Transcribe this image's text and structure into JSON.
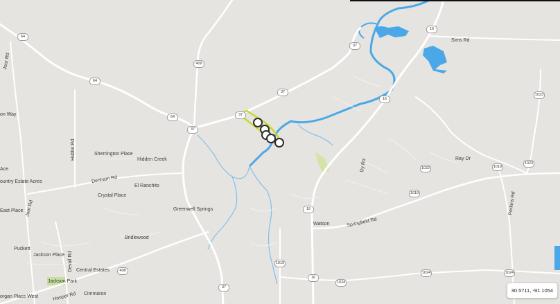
{
  "coordinates": "30.5711, -91.1054",
  "place_labels": {
    "sims_rd": "Sims Rd",
    "on_way": "on Way",
    "joor_rd_top": "Joor Rd",
    "hubbs_rd": "Hubbs Rd",
    "sherrington_place": "Sherrington Place",
    "hidden_creek": "Hidden Creek",
    "ace": "Ace",
    "country_estate_acres": "ountry Estate Acres",
    "denham_rd": "Denham Rd",
    "el_ranchito": "El Ranchito",
    "crystal_place": "Crystal Place",
    "joor_rd_bottom": "Joor Rd",
    "east_place": "East Place",
    "greenwell_springs": "Greenwell Springs",
    "bridlewood": "Bridlewood",
    "puckett": "Puckett",
    "jackson_place": "Jackson Place",
    "devall_rd": "Devall Rd",
    "central_estates": "Central Estates",
    "jackson_park": "Jackson Park",
    "cimmaron": "Cimmaron",
    "hooper_rd": "Hooper Rd",
    "organ_place_west": "organ Place West",
    "watson": "Watson",
    "springfield_rd": "Springfield Rd",
    "ray_dr": "Ray Dr",
    "perkins_rd": "Perkins Rd",
    "dy_rd": "Dy Rd"
  },
  "shields": {
    "r64a": "64",
    "r64b": "64",
    "r64c": "64",
    "r409": "409",
    "r37a": "37",
    "r37b": "37",
    "r37c": "37",
    "r37d": "37",
    "r37e": "37",
    "r16a": "16",
    "r16b": "16",
    "r16c": "16",
    "r16d": "16",
    "r1023a": "1023",
    "r1023b": "1023",
    "r1022": "1022",
    "r1019a": "1019",
    "r1019b": "1019",
    "r1019c": "1019",
    "r1024a": "1024",
    "r1024b": "1024",
    "r1024c": "1024",
    "r408": "408"
  },
  "colors": {
    "land": "#e6e4e0",
    "road": "#ffffff",
    "water": "#4aa8e8",
    "river": "#7fc0ea",
    "highlight": "#c9d82a",
    "park": "#c6df9e",
    "marker": "#2b2b2b"
  },
  "markers": {
    "count": 5
  }
}
